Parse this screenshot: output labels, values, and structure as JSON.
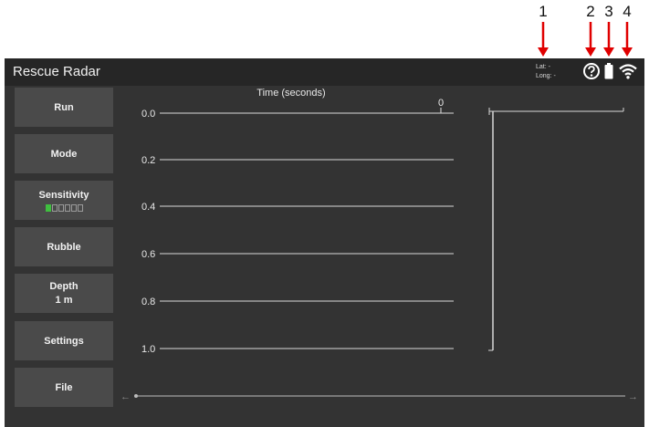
{
  "annotations": {
    "callouts": [
      "1",
      "2",
      "3",
      "4"
    ],
    "arrow_color": "#e00000"
  },
  "app": {
    "title": "Rescue Radar",
    "gps": {
      "lat": "Lat: -",
      "long": "Long: -"
    },
    "icons": [
      "help-icon",
      "battery-icon",
      "wifi-icon"
    ]
  },
  "menu": {
    "run": "Run",
    "mode": "Mode",
    "sensitivity": {
      "label": "Sensitivity",
      "level": 1,
      "max": 6
    },
    "rubble": "Rubble",
    "depth": {
      "label": "Depth",
      "value": "1 m"
    },
    "settings": "Settings",
    "file": "File"
  },
  "plot": {
    "title": "Time (seconds)",
    "top_marker": "0",
    "y_ticks": [
      "0.0",
      "0.2",
      "0.4",
      "0.6",
      "0.8",
      "1.0"
    ]
  },
  "scroll": {
    "left_arrow": "←",
    "right_arrow": "→"
  },
  "colors": {
    "accent_green": "#3fbf3f",
    "panel": "#333333",
    "topbar": "#262626",
    "button": "#4a4a4a"
  }
}
